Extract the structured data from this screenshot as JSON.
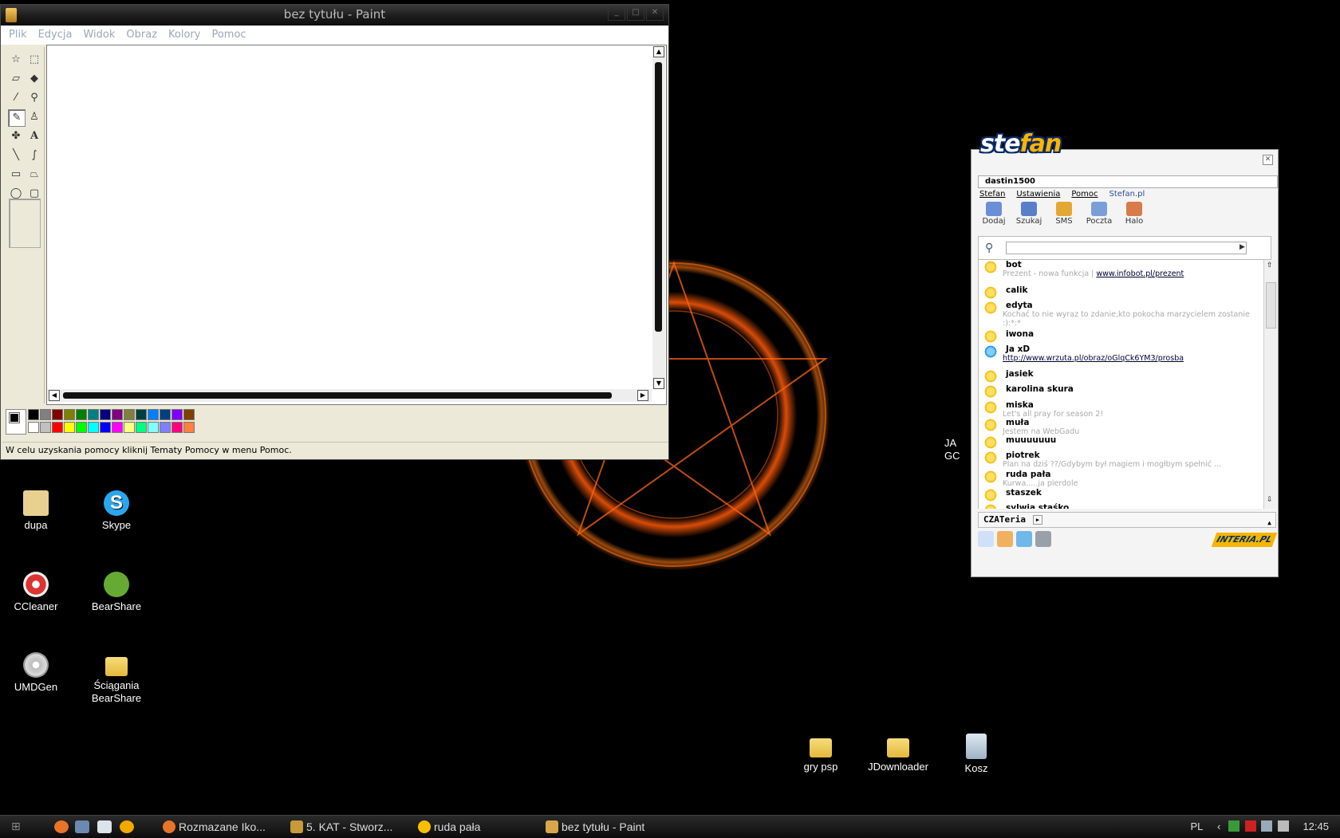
{
  "paint": {
    "title": "bez tytułu - Paint",
    "menu": [
      "Plik",
      "Edycja",
      "Widok",
      "Obraz",
      "Kolory",
      "Pomoc"
    ],
    "status": "W celu uzyskania pomocy kliknij Tematy Pomocy w menu Pomoc.",
    "palette_top": [
      "#000000",
      "#808080",
      "#800000",
      "#808000",
      "#008000",
      "#008080",
      "#000080",
      "#800080",
      "#808040",
      "#004040",
      "#0080ff",
      "#004080",
      "#8000ff",
      "#804000"
    ],
    "palette_bottom": [
      "#ffffff",
      "#c0c0c0",
      "#ff0000",
      "#ffff00",
      "#00ff00",
      "#00ffff",
      "#0000ff",
      "#ff00ff",
      "#ffff80",
      "#00ff80",
      "#80ffff",
      "#8080ff",
      "#ff0080",
      "#ff8040"
    ]
  },
  "desktop_icons": [
    "dupa",
    "Skype",
    "CCleaner",
    "BearShare",
    "UMDGen",
    "Ściągania BearShare",
    "gry psp",
    "JDownloader",
    "Kosz"
  ],
  "partial_icon": [
    "JA",
    "GC"
  ],
  "stefan": {
    "logo": [
      "ste",
      "fan"
    ],
    "username": "dastin1500",
    "menu": [
      "Stefan",
      "Ustawienia",
      "Pomoc",
      "Stefan.pl"
    ],
    "toolbar": [
      "Dodaj",
      "Szukaj",
      "SMS",
      "Poczta",
      "Halo"
    ],
    "contacts": [
      {
        "name": "bot",
        "desc": "Prezent - nowa funkcja | ",
        "link": "www.infobot.pl/prezent"
      },
      {
        "name": "calik",
        "desc": "",
        "link": ""
      },
      {
        "name": "edyta",
        "desc": "Kochać to nie wyraz to zdanie,kto pokocha marzycielem zostanie",
        "link": ""
      },
      {
        "name": "",
        "desc": ":):*:*",
        "link": ""
      },
      {
        "name": "iwona",
        "desc": "",
        "link": ""
      },
      {
        "name": "Ja xD",
        "desc": "",
        "link": "http://www.wrzuta.pl/obraz/oGlqCk6YM3/prosba"
      },
      {
        "name": "jasiek",
        "desc": "",
        "link": ""
      },
      {
        "name": "karolina skura",
        "desc": "",
        "link": ""
      },
      {
        "name": "miska",
        "desc": "Let's all pray for season 2!",
        "link": ""
      },
      {
        "name": "muła",
        "desc": "Jestem na WebGadu",
        "link": ""
      },
      {
        "name": "muuuuuuu",
        "desc": "",
        "link": ""
      },
      {
        "name": "piotrek",
        "desc": "Plan na dziś ??/Gdybym był magiem i mogłbym spełnić ...",
        "link": ""
      },
      {
        "name": "ruda pała",
        "desc": "Kurwa.....ja pierdole",
        "link": ""
      },
      {
        "name": "staszek",
        "desc": "",
        "link": ""
      },
      {
        "name": "sylwia staśko",
        "desc": "",
        "link": ""
      }
    ],
    "czat": "CZATeria",
    "brand": "INTERIA.PL"
  },
  "taskbar": {
    "tasks": [
      "Rozmazane Iko...",
      "5. KAT - Stworz...",
      "ruda pała",
      "bez tytułu - Paint"
    ],
    "lang": "PL",
    "clock": "12:45"
  }
}
